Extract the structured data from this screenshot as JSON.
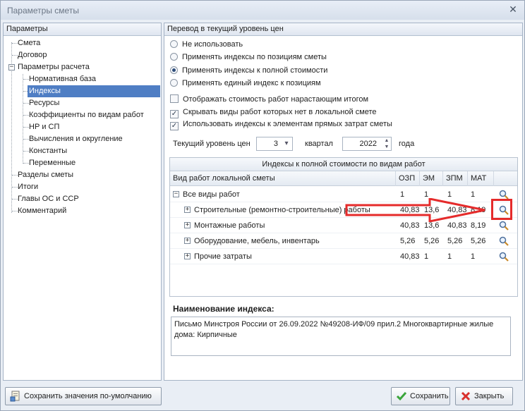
{
  "window": {
    "title": "Параметры сметы",
    "close_glyph": "✕"
  },
  "left": {
    "header": "Параметры",
    "items": [
      {
        "label": "Смета"
      },
      {
        "label": "Договор"
      },
      {
        "label": "Параметры расчета"
      },
      {
        "label": "Нормативная база"
      },
      {
        "label": "Индексы"
      },
      {
        "label": "Ресурсы"
      },
      {
        "label": "Коэффициенты по видам работ"
      },
      {
        "label": "НР и СП"
      },
      {
        "label": "Вычисления и округление"
      },
      {
        "label": "Константы"
      },
      {
        "label": "Переменные"
      },
      {
        "label": "Разделы сметы"
      },
      {
        "label": "Итоги"
      },
      {
        "label": "Главы ОС и ССР"
      },
      {
        "label": "Комментарий"
      }
    ],
    "selected": "Индексы",
    "expander_minus": "−"
  },
  "right": {
    "header": "Перевод в текущий уровень цен",
    "radios": [
      {
        "label": "Не использовать",
        "checked": false
      },
      {
        "label": "Применять индексы по позициям сметы",
        "checked": false
      },
      {
        "label": "Применять индексы к полной стоимости",
        "checked": true
      },
      {
        "label": "Применять единый индекс к позициям",
        "checked": false
      }
    ],
    "checks": [
      {
        "label": "Отображать стоимость работ нарастающим итогом",
        "mark": ""
      },
      {
        "label": "Скрывать виды работ которых нет в локальной смете",
        "mark": "✓"
      },
      {
        "label": "Использовать индексы к элементам прямых затрат сметы",
        "mark": "✓"
      }
    ],
    "level": {
      "label": "Текущий уровень цен",
      "quarter_value": "3",
      "quarter_label": "квартал",
      "year_value": "2022",
      "year_label": "года",
      "spin_glyphs": "▲▼",
      "dropdown_glyph": "▾"
    },
    "grid": {
      "caption": "Индексы к полной стоимости по видам работ",
      "columns": [
        "Вид работ локальной сметы",
        "ОЗП",
        "ЭМ",
        "ЗПМ",
        "МАТ"
      ],
      "rows": [
        {
          "expander": "−",
          "name": "Все виды работ",
          "ozp": "1",
          "em": "1",
          "zpm": "1",
          "mat": "1"
        },
        {
          "expander": "+",
          "name": "Строительные (ремонтно-строительные) работы",
          "ozp": "40,83",
          "em": "13,6",
          "zpm": "40,83",
          "mat": "8,19"
        },
        {
          "expander": "+",
          "name": "Монтажные работы",
          "ozp": "40,83",
          "em": "13,6",
          "zpm": "40,83",
          "mat": "8,19"
        },
        {
          "expander": "+",
          "name": "Оборудование, мебель, инвентарь",
          "ozp": "5,26",
          "em": "5,26",
          "zpm": "5,26",
          "mat": "5,26"
        },
        {
          "expander": "+",
          "name": "Прочие затраты",
          "ozp": "40,83",
          "em": "1",
          "zpm": "1",
          "mat": "1"
        }
      ]
    },
    "index_name": {
      "label": "Наименование индекса:",
      "value": "Письмо Минстроя России от 26.09.2022 №49208-ИФ/09 прил.2 Многоквартирные жилые дома: Кирпичные"
    }
  },
  "buttons": {
    "save_default": "Сохранить значения по-умолчанию",
    "save": "Сохранить",
    "close": "Закрыть"
  },
  "icons": {
    "magnifier": "magnifier-icon",
    "save_default": "save-defaults-icon",
    "save": "checkmark-icon",
    "close": "cross-icon"
  },
  "colors": {
    "selection": "#4f7ec4",
    "annotation": "#e52b2b",
    "save_icon": "#3aa53a",
    "close_icon": "#d9302c"
  }
}
